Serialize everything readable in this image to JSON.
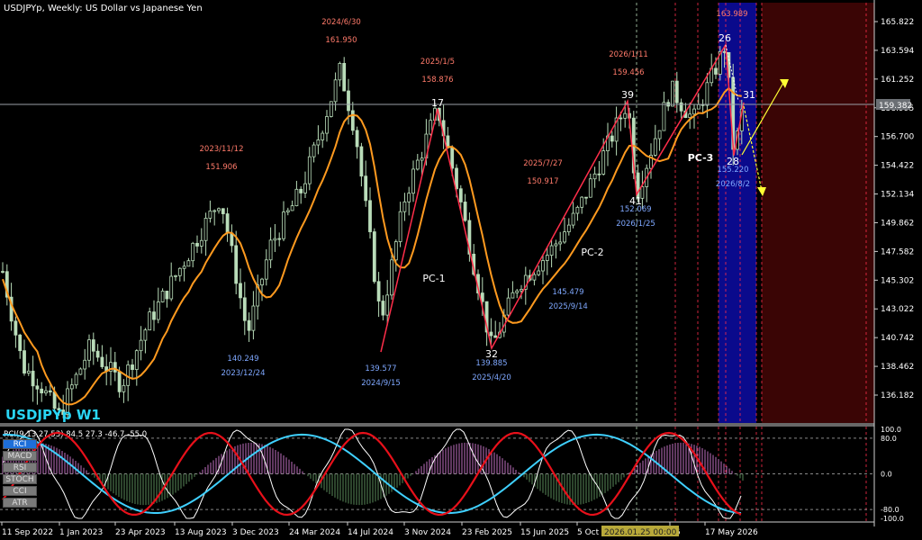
{
  "header": {
    "title": "USDJPYp, Weekly:  US Dollar vs Japanese Yen"
  },
  "symbol_label": "USDJPYp W1",
  "rci_header": "RCI(9,13,27,53) 84.5 27.3 -46.7 -55.0",
  "indicator_buttons": [
    "RCI",
    "MACD",
    "RSI",
    "STOCH",
    "CCI",
    "ATR"
  ],
  "current_price_label": "159.382",
  "time_cursor_label": "2026.01.25 00:00",
  "colors": {
    "background": "#000000",
    "bull_candle": "#b9dcb9",
    "ma": "#ff9a1f",
    "zigzag": "#ff2e4a",
    "high_label": "#ff7a6a",
    "low_label": "#7fa8ff",
    "rci_white": "#ffffff",
    "rci_red": "#e8101a",
    "rci_cyan": "#3fd0ff",
    "symbol_label": "#29d6f5",
    "blue_zone": "#0a0a8c",
    "red_zone": "#3a0505"
  },
  "chart_data": {
    "type": "candlestick",
    "title": "USDJPYp, Weekly:  US Dollar vs Japanese Yen",
    "y_ticks": [
      "165.822",
      "163.594",
      "161.252",
      "158.995",
      "156.700",
      "154.422",
      "152.134",
      "149.862",
      "147.582",
      "145.302",
      "143.022",
      "140.742",
      "138.462",
      "136.182"
    ],
    "ylim": [
      134.5,
      167.2
    ],
    "x_ticks": [
      "11 Sep 2022",
      "1 Jan 2023",
      "23 Apr 2023",
      "13 Aug 2023",
      "3 Dec 2023",
      "24 Mar 2024",
      "14 Jul 2024",
      "3 Nov 2024",
      "23 Feb 2025",
      "15 Jun 2025",
      "5 Oct",
      "26",
      "17 May 2026"
    ],
    "zigzag": [
      {
        "label": "",
        "price": 139.6
      },
      {
        "label": "17",
        "price": 158.9
      },
      {
        "label": "32",
        "price": 139.9
      },
      {
        "label": "39",
        "price": 159.5
      },
      {
        "label": "41",
        "price": 152.1
      },
      {
        "label": "26",
        "price": 164.0
      },
      {
        "label": "28",
        "price": 155.2
      },
      {
        "label": "31",
        "price": 159.4
      }
    ],
    "pivot_annotations": [
      {
        "date": "2024/6/30",
        "price": "161.950",
        "type": "high"
      },
      {
        "date": "2025/1/5",
        "price": "158.876",
        "type": "high"
      },
      {
        "date": "2026/1/11",
        "price": "159.456",
        "type": "high"
      },
      {
        "date": "",
        "price": "163.989",
        "type": "high"
      },
      {
        "date": "2023/11/12",
        "price": "151.906",
        "type": "high"
      },
      {
        "date": "2025/7/27",
        "price": "150.917",
        "type": "high"
      },
      {
        "date": "2023/12/24",
        "price": "140.249",
        "type": "low"
      },
      {
        "date": "2024/9/15",
        "price": "139.577",
        "type": "low"
      },
      {
        "date": "2025/4/20",
        "price": "139.885",
        "type": "low"
      },
      {
        "date": "2025/9/14",
        "price": "145.479",
        "type": "low"
      },
      {
        "date": "2026/1/25",
        "price": "152.069",
        "type": "low"
      },
      {
        "date": "2026/8/2",
        "price": "155.220",
        "type": "low"
      }
    ],
    "pattern_labels": [
      "PC-1",
      "PC-2",
      "PC-3"
    ],
    "rci_axis_ticks": [
      "100.0",
      "80.0",
      "0.0",
      "-80.0",
      "-100.0"
    ]
  }
}
